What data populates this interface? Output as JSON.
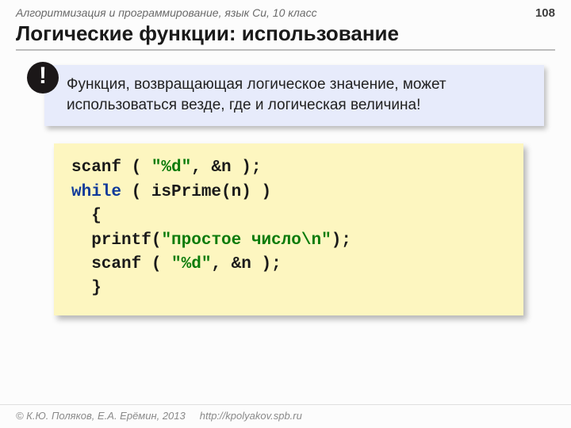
{
  "topbar": {
    "course": "Алгоритмизация и программирование, язык Си, 10 класс",
    "page": "108"
  },
  "title": "Логические функции: использование",
  "note": {
    "badge": "!",
    "text": "Функция, возвращающая логическое значение, может использоваться везде, где и логическая величина!"
  },
  "code": {
    "l1a": "scanf",
    "l1b": " ( ",
    "l1c": "\"%d\"",
    "l1d": ", &n );",
    "l2a": "while",
    "l2b": " ( isPrime(n) )",
    "l3": "  {",
    "l4a": "  printf",
    "l4b": "(",
    "l4c": "\"простое число\\n\"",
    "l4d": ");",
    "l5a": "  scanf",
    "l5b": " ( ",
    "l5c": "\"%d\"",
    "l5d": ", &n );",
    "l6": "  }"
  },
  "footer": {
    "copyright": "© К.Ю. Поляков, Е.А. Ерёмин, 2013",
    "url": "http://kpolyakov.spb.ru"
  }
}
